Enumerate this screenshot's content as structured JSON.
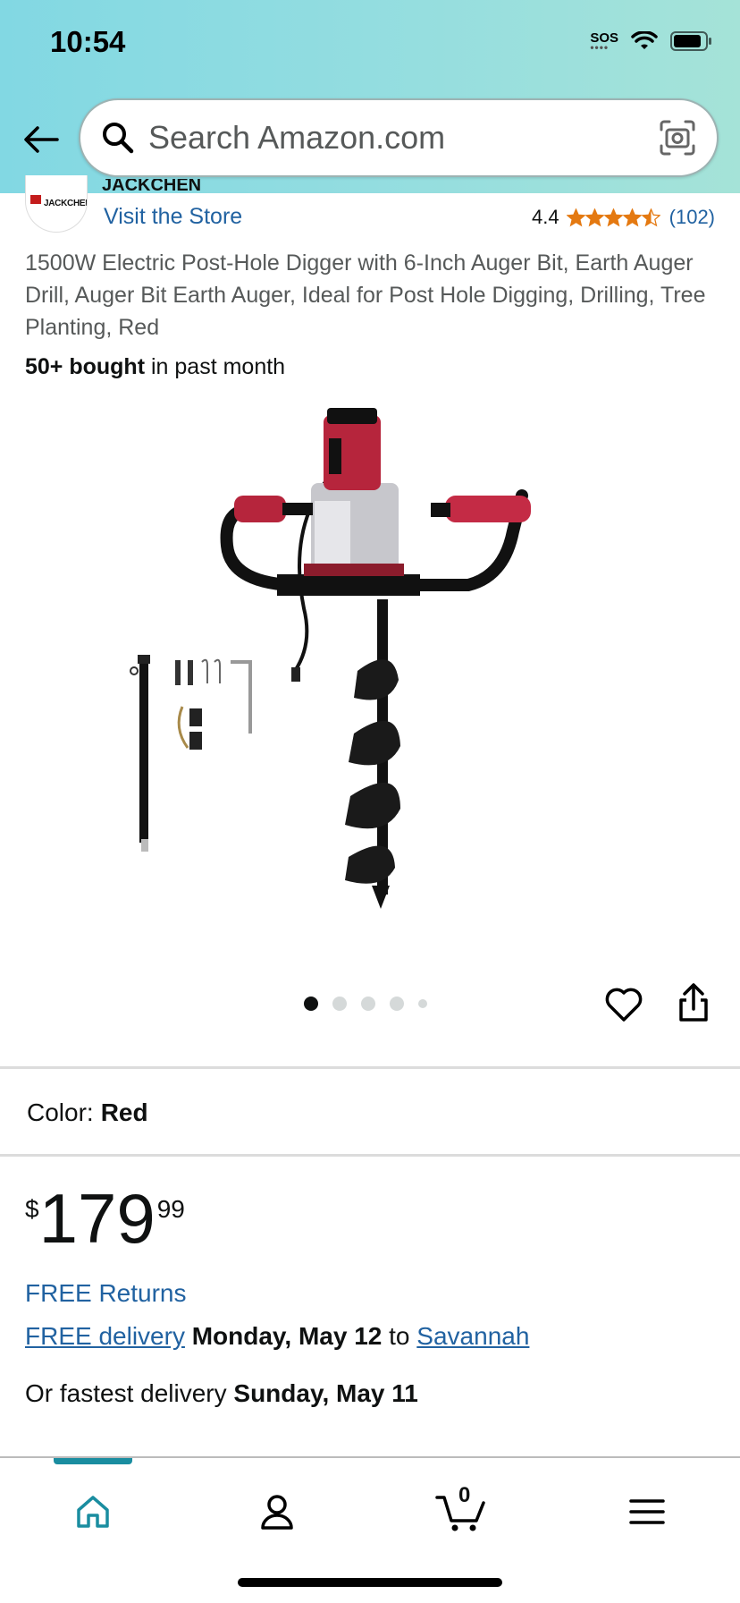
{
  "status_bar": {
    "time": "10:54",
    "sos": "SOS"
  },
  "search": {
    "placeholder": "Search Amazon.com"
  },
  "store": {
    "logo_text": "JACKCHEN",
    "brand_partial": "JACKCHEN",
    "visit_label": "Visit the Store"
  },
  "rating": {
    "value": "4.4",
    "stars": 4.5,
    "count": "(102)",
    "star_color": "#e47911"
  },
  "product": {
    "title": "1500W Electric Post-Hole Digger with 6-Inch Auger Bit, Earth Auger Drill, Auger Bit Earth Auger, Ideal for Post Hole Digging, Drilling, Tree Planting, Red",
    "bought_bold": "50+ bought",
    "bought_rest": " in past month",
    "image_count": 5,
    "active_image": 1
  },
  "color": {
    "label": "Color:",
    "value": "Red"
  },
  "price": {
    "symbol": "$",
    "whole": "179",
    "fraction": "99"
  },
  "shipping": {
    "free_returns": "FREE Returns",
    "free_delivery": "FREE delivery",
    "delivery_date": "Monday, May 12",
    "to": " to ",
    "location": "Savannah",
    "fastest_prefix": "Or fastest delivery ",
    "fastest_date": "Sunday, May 11"
  },
  "bottom_nav": {
    "items": [
      "home-icon",
      "account-icon",
      "cart-icon",
      "menu-icon"
    ],
    "cart_count": "0",
    "accent": "#1a8da0"
  },
  "colors": {
    "link": "#2162a1",
    "text": "#0f1111",
    "header_start": "#82d8e3",
    "header_end": "#a5e3d8"
  }
}
